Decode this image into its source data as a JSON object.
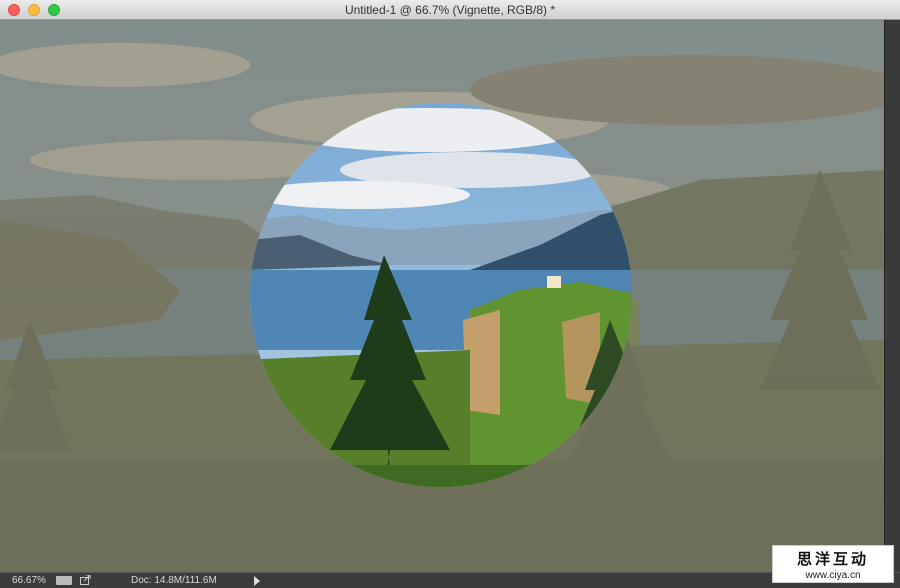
{
  "window": {
    "title": "Untitled-1 @ 66.7% (Vignette, RGB/8) *"
  },
  "status": {
    "zoom": "66.67%",
    "doc": "Doc: 14.8M/111.6M"
  },
  "watermark": {
    "chinese": "思洋互动",
    "url": "www.ciya.cn"
  },
  "colors": {
    "sky": "#8cb7d9",
    "water": "#4f86b3",
    "forest": "#4d7a2c",
    "sepia_overlay": "#8b8672"
  }
}
